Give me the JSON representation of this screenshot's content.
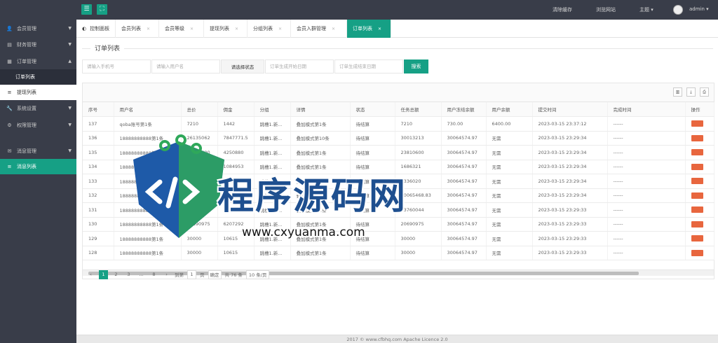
{
  "header": {
    "links": [
      "清除缓存",
      "浏览网站",
      "主题 ▾",
      "admin ▾"
    ]
  },
  "sidebar": {
    "items": [
      {
        "label": "会员管理",
        "icon": "user-icon"
      },
      {
        "label": "财务管理",
        "icon": "finance-icon"
      },
      {
        "label": "订单管理",
        "icon": "order-icon"
      },
      {
        "label": "订单列表",
        "icon": ""
      },
      {
        "label": "提现列表",
        "icon": "list-icon"
      },
      {
        "label": "系统设置",
        "icon": "wrench-icon"
      },
      {
        "label": "权限管理",
        "icon": "gear-icon"
      },
      {
        "label": "消息管理",
        "icon": "message-icon"
      },
      {
        "label": "消息列表",
        "icon": "list-icon"
      }
    ]
  },
  "tabs": [
    {
      "label": "控制面板"
    },
    {
      "label": "会员列表"
    },
    {
      "label": "会员等级"
    },
    {
      "label": "提现列表"
    },
    {
      "label": "分组列表"
    },
    {
      "label": "会员入群管理"
    },
    {
      "label": "订单列表"
    }
  ],
  "panel": {
    "title": "订单列表",
    "filters": {
      "phone_placeholder": "请输入手机号",
      "user_placeholder": "请输入用户名",
      "status_select": "请选择状态",
      "start_placeholder": "订单生成开始日期",
      "end_placeholder": "订单生成结束日期",
      "search_label": "搜索"
    }
  },
  "table": {
    "columns": [
      "序号",
      "用户名",
      "总价",
      "佣金",
      "分组",
      "详情",
      "状态",
      "任务总额",
      "用户冻结余额",
      "用户余额",
      "提交时间",
      "完成时间",
      "操作"
    ],
    "rows": [
      [
        "137",
        "qoba账号第1条",
        "7210",
        "1442",
        "跳槽1.新...",
        "叠加模式第1条",
        "待结算",
        "7210",
        "730.00",
        "6400.00",
        "2023-03-15 23:37:12",
        "------",
        ""
      ],
      [
        "136",
        "18888888888第1条",
        "26135062",
        "7847771.5",
        "跳槽1.新...",
        "叠加模式第10条",
        "待结算",
        "30013213",
        "30064574.97",
        "无需",
        "2023-03-15 23:29:34",
        "------",
        ""
      ],
      [
        "135",
        "18888888888第1条",
        "14189600",
        "4250880",
        "跳槽1.新...",
        "叠加模式第1条",
        "待结算",
        "23810600",
        "30064574.97",
        "无需",
        "2023-03-15 23:29:34",
        "------",
        ""
      ],
      [
        "134",
        "18888888888第1条",
        "1686321",
        "1084953",
        "跳槽1.新...",
        "叠加模式第1条",
        "待结算",
        "1686321",
        "30064574.97",
        "无需",
        "2023-03-15 23:29:34",
        "------",
        ""
      ],
      [
        "133",
        "18888888888第1条",
        "4336020",
        "1300806.5",
        "跳槽1.新...",
        "叠加模式第1条",
        "待结算",
        "4336020",
        "30064574.97",
        "无需",
        "2023-03-15 23:29:34",
        "------",
        ""
      ],
      [
        "132",
        "18888888888第1条",
        "20065468.83",
        "6019640.6",
        "跳槽1.新...",
        "叠加模式第1条",
        "待结算",
        "20065468.83",
        "30064574.97",
        "无需",
        "2023-03-15 23:29:34",
        "------",
        ""
      ],
      [
        "131",
        "18888888888第1条",
        "8376004",
        "4383373",
        "跳槽1.新...",
        "叠加模式第1条",
        "待结算",
        "83760044",
        "30064574.97",
        "无需",
        "2023-03-15 23:29:33",
        "------",
        ""
      ],
      [
        "130",
        "18888888888第1条",
        "20690975",
        "6207292",
        "跳槽1.新...",
        "叠加模式第1条",
        "待结算",
        "20690975",
        "30064574.97",
        "无需",
        "2023-03-15 23:29:33",
        "------",
        ""
      ],
      [
        "129",
        "18888888888第1条",
        "30000",
        "10615",
        "跳槽1.新...",
        "叠加模式第1条",
        "待结算",
        "30000",
        "30064574.97",
        "无需",
        "2023-03-15 23:29:33",
        "------",
        ""
      ],
      [
        "128",
        "18888888888第1条",
        "30000",
        "10615",
        "跳槽1.新...",
        "叠加模式第1条",
        "待结算",
        "30000",
        "30064574.97",
        "无需",
        "2023-03-15 23:29:33",
        "------",
        ""
      ]
    ]
  },
  "pager": {
    "prev": "‹",
    "pages": [
      "1",
      "2",
      "3",
      "...",
      "8"
    ],
    "next": "›",
    "goto_label": "到第",
    "goto_value": "1",
    "page_unit": "页",
    "confirm": "确定",
    "total": "共 76 条",
    "per_page": "10 条/页"
  },
  "footer": {
    "text": "2017 © www.cfbhq.com Apache Licence 2.0"
  },
  "watermark": {
    "title": "程序源码网",
    "url": "www.cxyuanma.com"
  }
}
